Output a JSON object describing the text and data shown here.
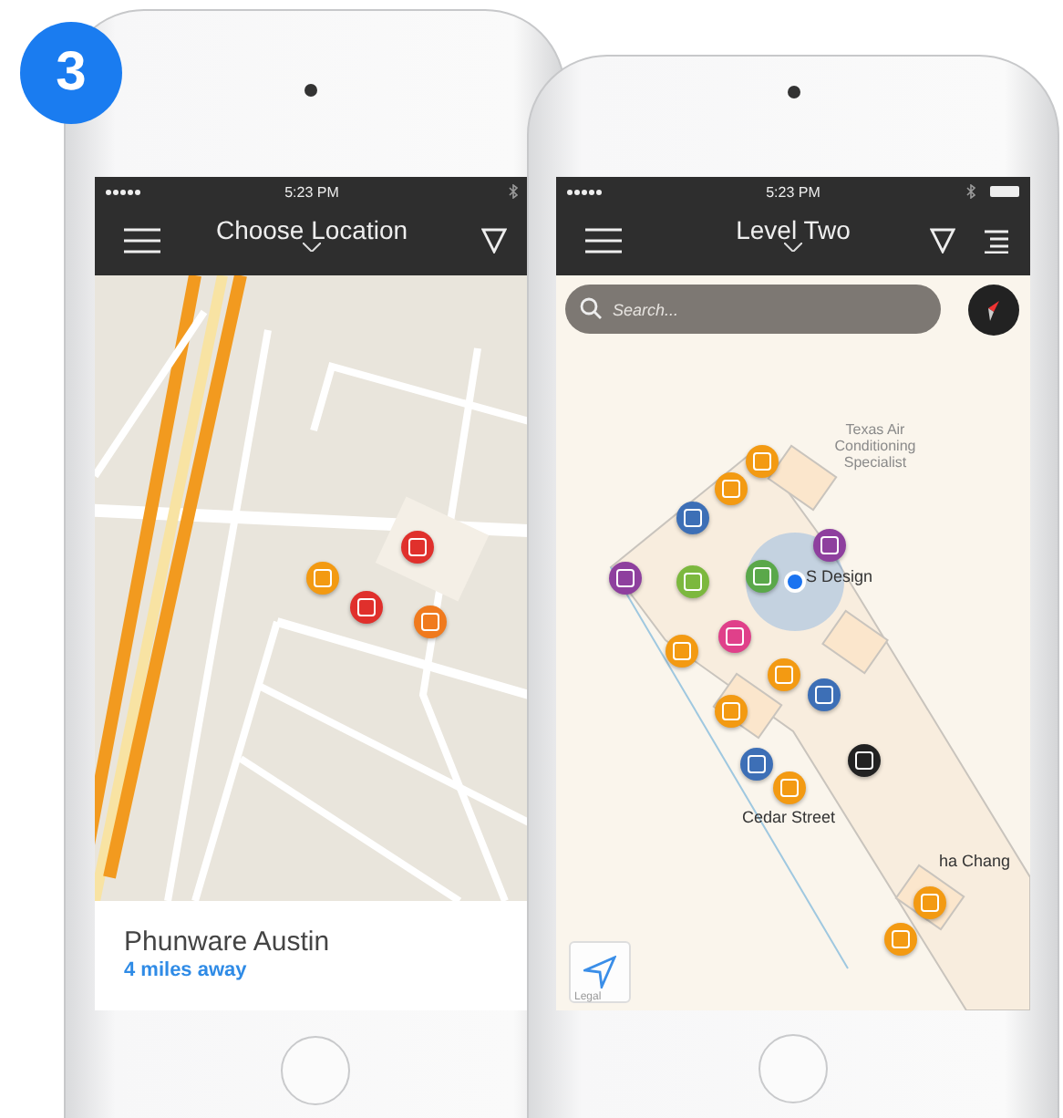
{
  "badge": "3",
  "left_phone": {
    "status_time": "5:23 PM",
    "title": "Choose Location",
    "pins": [
      {
        "color": "#e0302c"
      },
      {
        "color": "#f39a12"
      },
      {
        "color": "#e0302c"
      },
      {
        "color": "#f07a1e"
      }
    ],
    "location": {
      "name": "Phunware Austin",
      "distance": "4 miles away"
    }
  },
  "right_phone": {
    "status_time": "5:23 PM",
    "title": "Level Two",
    "search": {
      "placeholder": "Search..."
    },
    "map_labels": [
      "Texas Air Conditioning Specialist",
      "S Design",
      "Cedar Street",
      "ha Chang"
    ],
    "pins": [
      {
        "color": "#f39a12"
      },
      {
        "color": "#f39a12"
      },
      {
        "color": "#3d6fb6"
      },
      {
        "color": "#8e3f9e"
      },
      {
        "color": "#8e3f9e"
      },
      {
        "color": "#7cb83e"
      },
      {
        "color": "#5aa84a"
      },
      {
        "color": "#e0408a"
      },
      {
        "color": "#f39a12"
      },
      {
        "color": "#f39a12"
      },
      {
        "color": "#3d6fb6"
      },
      {
        "color": "#f39a12"
      },
      {
        "color": "#3d6fb6"
      },
      {
        "color": "#222222"
      },
      {
        "color": "#f39a12"
      },
      {
        "color": "#f39a12"
      },
      {
        "color": "#f39a12"
      }
    ],
    "legal": "Legal"
  }
}
